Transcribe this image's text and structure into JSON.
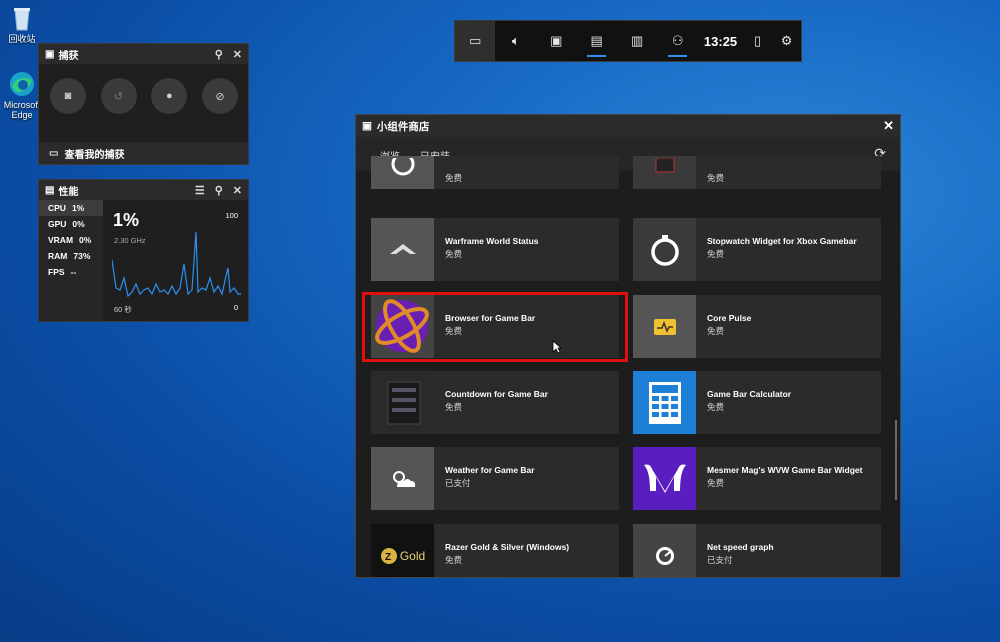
{
  "desktop": {
    "recycle_label": "回收站",
    "edge_label_1": "Microsoft",
    "edge_label_2": "Edge"
  },
  "capture_widget": {
    "title": "捕获",
    "footer": "查看我的捕获"
  },
  "performance_widget": {
    "title": "性能",
    "metrics": [
      {
        "label": "CPU",
        "value": "1%"
      },
      {
        "label": "GPU",
        "value": "0%"
      },
      {
        "label": "VRAM",
        "value": "0%"
      },
      {
        "label": "RAM",
        "value": "73%"
      },
      {
        "label": "FPS",
        "value": "--"
      }
    ],
    "big_value": "1%",
    "freq": "2.30 GHz",
    "max": "100",
    "duration": "60 秒",
    "min": "0"
  },
  "gamebar": {
    "time": "13:25"
  },
  "store": {
    "title": "小组件商店",
    "tabs": [
      "浏览",
      "已安装"
    ],
    "cards": [
      {
        "name": "",
        "price": "免费"
      },
      {
        "name": "",
        "price": "免费"
      },
      {
        "name": "Warframe World Status",
        "price": "免费"
      },
      {
        "name": "Stopwatch Widget for Xbox Gamebar",
        "price": "免费"
      },
      {
        "name": "Browser for Game Bar",
        "price": "免费"
      },
      {
        "name": "Core Pulse",
        "price": "免费"
      },
      {
        "name": "Countdown for Game Bar",
        "price": "免费"
      },
      {
        "name": "Game Bar Calculator",
        "price": "免费"
      },
      {
        "name": "Weather for Game Bar",
        "price": "已支付"
      },
      {
        "name": "Mesmer Mag's WVW Game Bar Widget",
        "price": "免费"
      },
      {
        "name": "Razer Gold & Silver (Windows)",
        "price": "免费"
      },
      {
        "name": "Net speed graph",
        "price": "已支付"
      }
    ],
    "razer_logo_text": "Gold"
  },
  "colors": {
    "accent": "#2d8ff0",
    "highlight": "#e11010",
    "desktop": "#1566c2"
  }
}
